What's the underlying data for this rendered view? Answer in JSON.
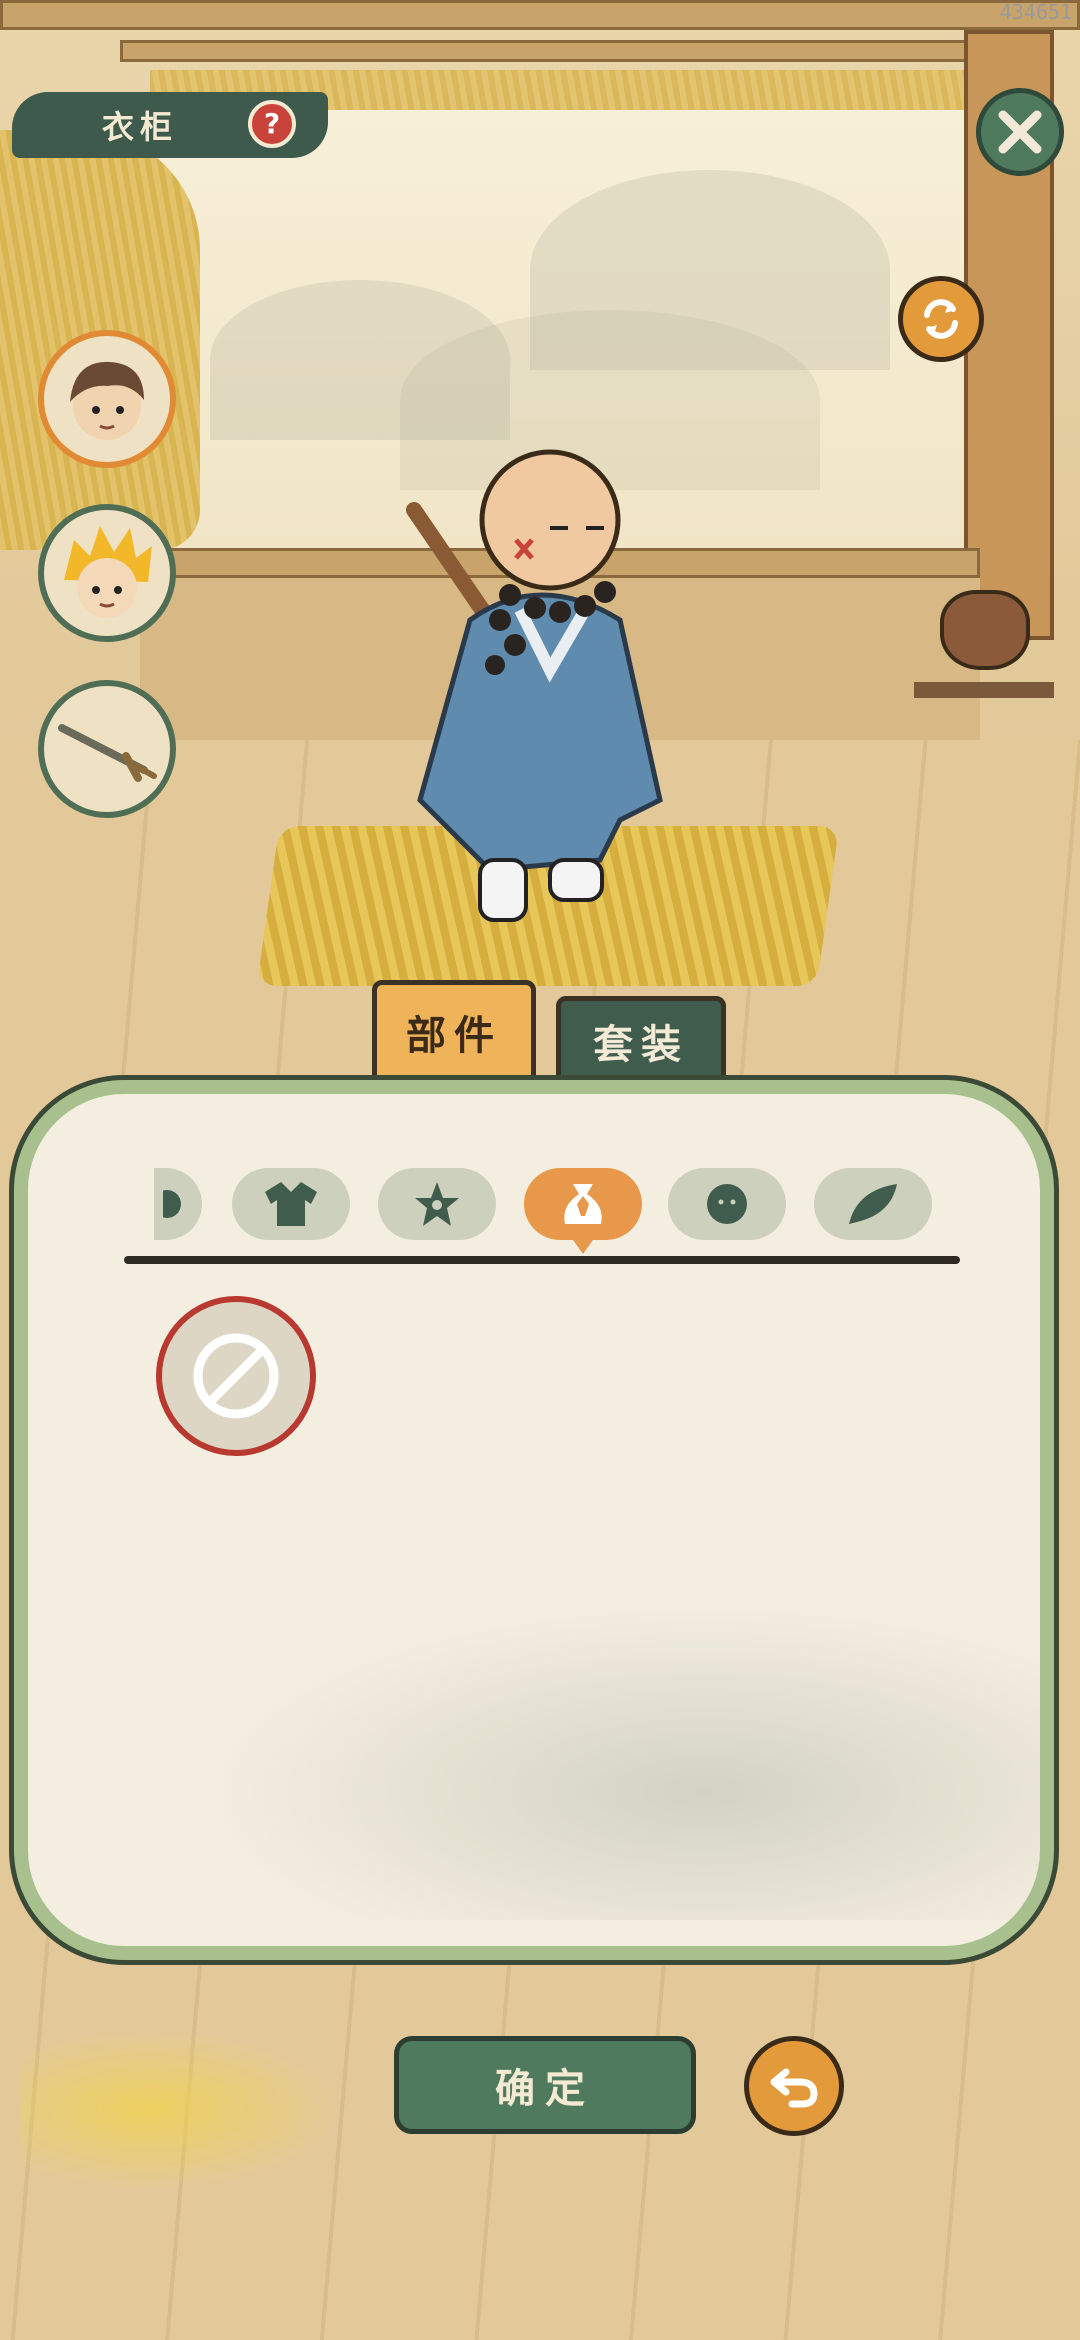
{
  "watermark": "434651",
  "header": {
    "title": "衣柜",
    "help_icon": "question-icon"
  },
  "buttons": {
    "close_icon": "close-icon",
    "swap_icon": "refresh-icon",
    "confirm_label": "确定",
    "back_icon": "undo-icon"
  },
  "characters": [
    {
      "name": "character-brown-hair",
      "active": true
    },
    {
      "name": "character-golden-hair",
      "active": false
    },
    {
      "name": "weapon-sword",
      "active": false
    }
  ],
  "tabs": {
    "parts_label": "部件",
    "outfit_label": "套装"
  },
  "categories": [
    {
      "icon": "partial-category-icon",
      "active": false
    },
    {
      "icon": "robe-icon",
      "active": false
    },
    {
      "icon": "flower-icon",
      "active": false
    },
    {
      "icon": "bag-icon",
      "active": true
    },
    {
      "icon": "face-icon",
      "active": false
    },
    {
      "icon": "leaf-icon",
      "active": false
    }
  ],
  "items": [
    {
      "icon": "none-icon",
      "selected": true
    }
  ],
  "colors": {
    "accent_orange": "#e8984a",
    "dark_green": "#3f5c4c",
    "panel_border": "#a8c08e",
    "none_red": "#b8392f"
  }
}
